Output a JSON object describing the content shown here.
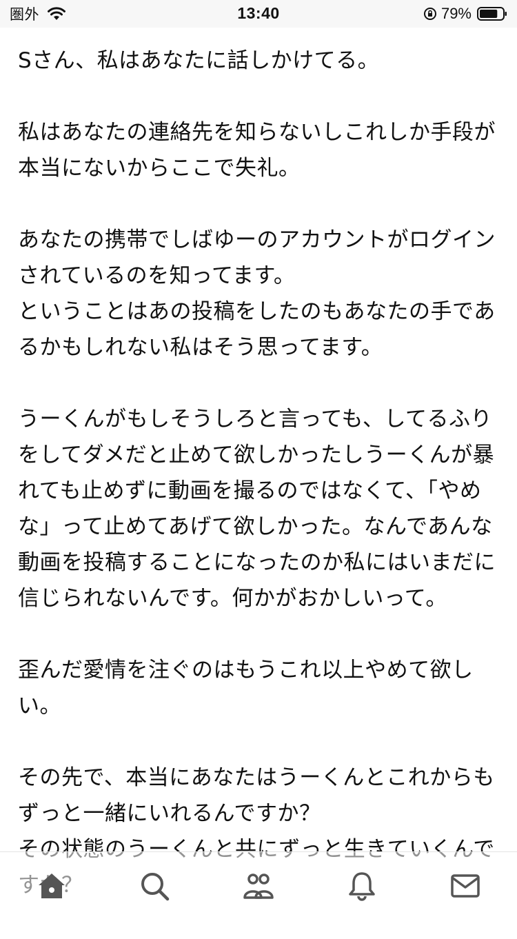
{
  "status_bar": {
    "carrier": "圏外",
    "time": "13:40",
    "battery_percent": "79%",
    "battery_level": 0.79,
    "icons": [
      "wifi-icon",
      "orientation-lock-icon",
      "battery-icon"
    ]
  },
  "post": {
    "paragraphs": [
      "Sさん、私はあなたに話しかけてる。",
      "私はあなたの連絡先を知らないしこれしか手段が本当にないからここで失礼。",
      "あなたの携帯でしばゆーのアカウントがログインされているのを知ってます。\nということはあの投稿をしたのもあなたの手であるかもしれない私はそう思ってます。",
      "うーくんがもしそうしろと言っても、してるふりをしてダメだと止めて欲しかったしうーくんが暴れても止めずに動画を撮るのではなくて、「やめな」って止めてあげて欲しかった。なんであんな動画を投稿することになったのか私にはいまだに信じられないんです。何かがおかしいって。",
      "歪んだ愛情を注ぐのはもうこれ以上やめて欲しい。",
      "その先で、本当にあなたはうーくんとこれからもずっと一緒にいれるんですか？\nその状態のうーくんと共にずっと生きていくんですか？"
    ]
  },
  "tab_bar": {
    "tabs": [
      {
        "name": "home",
        "icon": "home-icon",
        "active": true
      },
      {
        "name": "search",
        "icon": "search-icon",
        "active": false
      },
      {
        "name": "people",
        "icon": "people-icon",
        "active": false
      },
      {
        "name": "notifications",
        "icon": "bell-icon",
        "active": false
      },
      {
        "name": "messages",
        "icon": "mail-icon",
        "active": false
      }
    ],
    "icon_color": "#555555"
  }
}
